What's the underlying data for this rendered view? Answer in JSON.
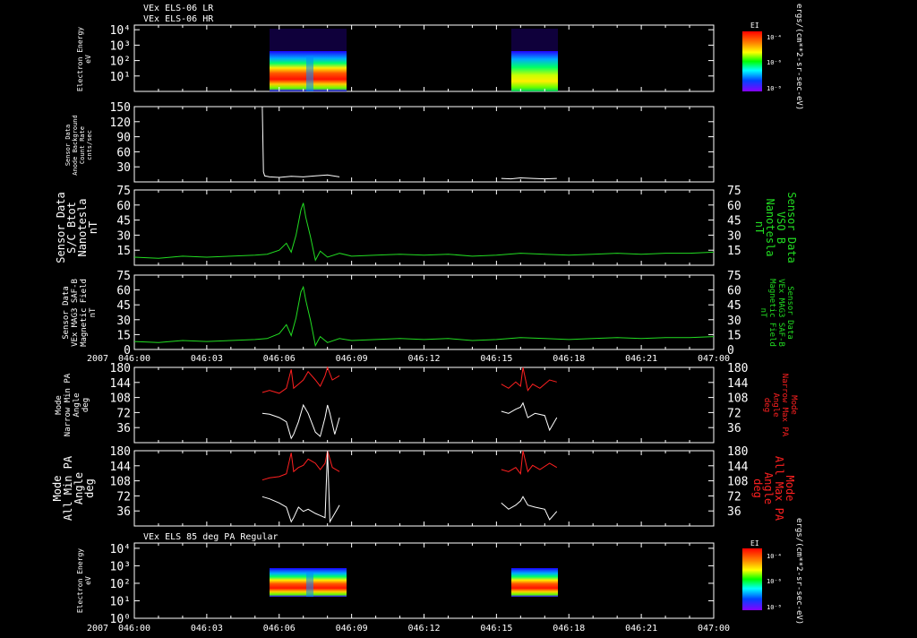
{
  "header": {
    "line1": "VEx ELS-06 LR",
    "line2": "VEx ELS-06 HR",
    "bottom_title": "VEx ELS 85 deg PA Regular"
  },
  "colorbar": {
    "title": "EI",
    "ticks": [
      "10⁻⁴",
      "10⁻⁶",
      "10⁻⁸"
    ],
    "side_label": "ergs/(cm**2-sr-sec-eV)"
  },
  "time_axis": {
    "year": "2007",
    "ticks": [
      "046:00",
      "046:03",
      "046:06",
      "046:09",
      "046:12",
      "046:15",
      "046:18",
      "046:21",
      "047:00"
    ]
  },
  "colors": {
    "white": "#ffffff",
    "green": "#22dd22",
    "red": "#ff2020",
    "label_green": "#22dd22",
    "label_red": "#ff2020"
  },
  "chart_data": [
    {
      "type": "heatmap",
      "title": "VEx ELS-06 LR",
      "ylabel": "Electron Energy\neV",
      "yscale": "log",
      "ylim": [
        1,
        20000
      ],
      "yticks": [
        "10⁴",
        "10³",
        "10²",
        "10¹"
      ],
      "intervals": [
        [
          "046:05:20",
          "046:08:30"
        ],
        [
          "046:15:10",
          "046:17:30"
        ]
      ],
      "colorbar_label": "EI ergs/(cm**2-sr-sec-eV)"
    },
    {
      "type": "line",
      "ylabel": "Sensor Data\nAnode Background\nCount Rate\ncnts/sec",
      "ylim": [
        0,
        150
      ],
      "yticks": [
        "150",
        "120",
        "90",
        "60",
        "30"
      ],
      "series": [
        {
          "color": "white",
          "x": [
            5.3,
            5.35,
            5.4,
            5.6,
            6.0,
            6.5,
            7.0,
            7.5,
            8.0,
            8.5
          ],
          "y": [
            150,
            20,
            12,
            10,
            9,
            11,
            10,
            12,
            14,
            10
          ]
        },
        {
          "color": "white",
          "x": [
            15.2,
            15.6,
            16.0,
            16.5,
            17.0,
            17.5
          ],
          "y": [
            7,
            6,
            8,
            7,
            6,
            7
          ]
        }
      ]
    },
    {
      "type": "line",
      "ylabel": "Sensor Data\nS/C Btot\nNanotesla\nnT",
      "ylabel_right": "Sensor Data\nVSO B\nNanotesla\nnT",
      "ylim": [
        0,
        75
      ],
      "yticks": [
        "75",
        "60",
        "45",
        "30",
        "15"
      ],
      "series": [
        {
          "color": "green",
          "x": [
            0,
            1,
            2,
            3,
            4,
            5,
            5.5,
            6.0,
            6.3,
            6.5,
            6.7,
            6.9,
            7.0,
            7.1,
            7.3,
            7.5,
            7.7,
            8.0,
            8.5,
            9,
            10,
            11,
            12,
            13,
            14,
            15,
            16,
            17,
            18,
            19,
            20,
            21,
            22,
            23,
            24
          ],
          "y": [
            8,
            7,
            9,
            8,
            9,
            10,
            11,
            15,
            22,
            13,
            30,
            55,
            62,
            48,
            28,
            5,
            14,
            8,
            12,
            9,
            10,
            11,
            10,
            11,
            9,
            10,
            12,
            11,
            10,
            11,
            12,
            11,
            12,
            12,
            13
          ]
        }
      ]
    },
    {
      "type": "line",
      "ylabel": "Sensor Data\nVEx MAG3 SAF-B\nMagnetic Field\nnT",
      "ylabel_right": "Sensor Data\nVEx MAG3 SAF-B\nMagnetic Field\nnT",
      "ylim": [
        0,
        75
      ],
      "yticks": [
        "75",
        "60",
        "45",
        "30",
        "15",
        "0"
      ],
      "series": [
        {
          "color": "green",
          "x": [
            0,
            1,
            2,
            3,
            4,
            5,
            5.5,
            6.0,
            6.3,
            6.5,
            6.7,
            6.9,
            7.0,
            7.1,
            7.3,
            7.5,
            7.7,
            8.0,
            8.5,
            9,
            10,
            11,
            12,
            13,
            14,
            15,
            16,
            17,
            18,
            19,
            20,
            21,
            22,
            23,
            24
          ],
          "y": [
            8,
            7,
            9,
            8,
            9,
            10,
            11,
            16,
            25,
            14,
            32,
            58,
            63,
            50,
            29,
            4,
            13,
            7,
            11,
            9,
            10,
            11,
            10,
            11,
            9,
            10,
            12,
            11,
            10,
            11,
            12,
            11,
            12,
            12,
            13
          ]
        }
      ]
    },
    {
      "type": "line",
      "ylabel": "Mode\nNarrow Min PA\nAngle\ndeg",
      "ylabel_right": "Mode\nNarrow Max PA\nAngle\ndeg",
      "ylim": [
        0,
        180
      ],
      "yticks": [
        "180",
        "144",
        "108",
        "72",
        "36"
      ],
      "series": [
        {
          "color": "red",
          "x": [
            5.3,
            5.6,
            6.0,
            6.3,
            6.5,
            6.6,
            6.8,
            7.0,
            7.2,
            7.5,
            7.7,
            7.9,
            8.0,
            8.1,
            8.2,
            8.5
          ],
          "y": [
            120,
            125,
            118,
            130,
            175,
            130,
            140,
            150,
            170,
            150,
            135,
            160,
            180,
            165,
            150,
            160
          ]
        },
        {
          "color": "white",
          "x": [
            5.3,
            5.6,
            6.0,
            6.3,
            6.5,
            6.6,
            6.8,
            7.0,
            7.2,
            7.5,
            7.7,
            7.9,
            8.0,
            8.1,
            8.3,
            8.5
          ],
          "y": [
            70,
            68,
            60,
            50,
            10,
            20,
            50,
            90,
            70,
            25,
            15,
            60,
            90,
            70,
            20,
            60
          ]
        },
        {
          "color": "red",
          "x": [
            15.2,
            15.5,
            15.8,
            16.0,
            16.1,
            16.3,
            16.5,
            16.8,
            17.2,
            17.5
          ],
          "y": [
            140,
            130,
            145,
            135,
            180,
            125,
            140,
            130,
            150,
            145
          ]
        },
        {
          "color": "white",
          "x": [
            15.2,
            15.5,
            15.8,
            16.0,
            16.1,
            16.3,
            16.6,
            17.0,
            17.2,
            17.5
          ],
          "y": [
            75,
            70,
            80,
            85,
            95,
            60,
            70,
            65,
            30,
            60
          ]
        }
      ]
    },
    {
      "type": "line",
      "ylabel": "Mode\nAll Min PA\nAngle\ndeg",
      "ylabel_right": "Mode\nAll Max PA\nAngle\ndeg",
      "ylim": [
        0,
        180
      ],
      "yticks": [
        "180",
        "144",
        "108",
        "72",
        "36"
      ],
      "series": [
        {
          "color": "red",
          "x": [
            5.3,
            5.6,
            6.0,
            6.3,
            6.5,
            6.6,
            6.8,
            7.0,
            7.2,
            7.5,
            7.7,
            7.9,
            8.0,
            8.1,
            8.2,
            8.5
          ],
          "y": [
            110,
            115,
            118,
            125,
            175,
            130,
            140,
            145,
            160,
            150,
            135,
            150,
            180,
            160,
            140,
            130
          ]
        },
        {
          "color": "white",
          "x": [
            5.3,
            5.6,
            6.0,
            6.3,
            6.5,
            6.6,
            6.8,
            7.0,
            7.2,
            7.5,
            7.7,
            7.9,
            8.0,
            8.1,
            8.3,
            8.5
          ],
          "y": [
            70,
            65,
            55,
            45,
            10,
            20,
            45,
            35,
            40,
            30,
            25,
            20,
            180,
            10,
            30,
            50
          ]
        },
        {
          "color": "red",
          "x": [
            15.2,
            15.5,
            15.8,
            16.0,
            16.1,
            16.3,
            16.5,
            16.8,
            17.2,
            17.5
          ],
          "y": [
            135,
            130,
            140,
            125,
            180,
            130,
            145,
            135,
            150,
            140
          ]
        },
        {
          "color": "white",
          "x": [
            15.2,
            15.5,
            15.8,
            16.0,
            16.1,
            16.3,
            16.6,
            17.0,
            17.2,
            17.5
          ],
          "y": [
            55,
            40,
            50,
            60,
            70,
            50,
            45,
            40,
            15,
            35
          ]
        }
      ]
    },
    {
      "type": "heatmap",
      "title": "VEx ELS 85 deg PA Regular",
      "ylabel": "Electron Energy\neV",
      "yscale": "log",
      "ylim": [
        1,
        20000
      ],
      "yticks": [
        "10⁴",
        "10³",
        "10²",
        "10¹",
        "10⁰"
      ],
      "intervals": [
        [
          "046:05:20",
          "046:08:30"
        ],
        [
          "046:15:10",
          "046:17:30"
        ]
      ],
      "colorbar_label": "EI ergs/(cm**2-sr-sec-eV)"
    }
  ]
}
